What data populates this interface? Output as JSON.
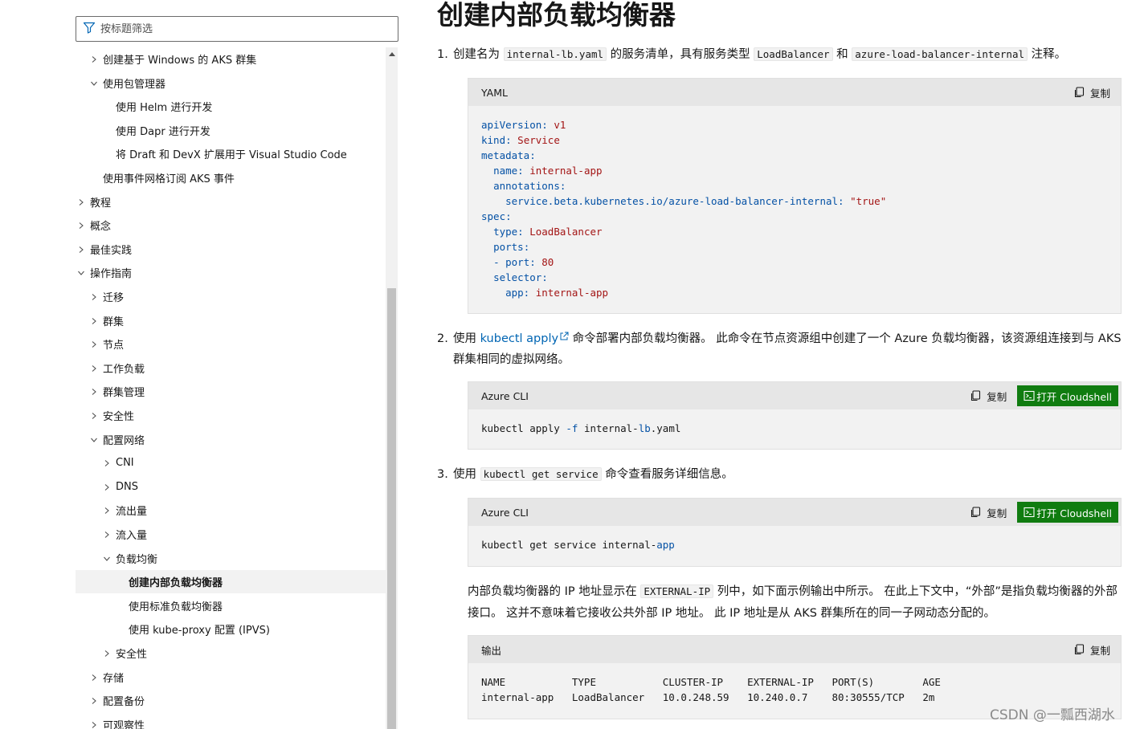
{
  "sidebar": {
    "filter_placeholder": "按标题筛选",
    "items": [
      {
        "label": "创建基于 Windows 的 AKS 群集",
        "level": 1,
        "chevron": "right"
      },
      {
        "label": "使用包管理器",
        "level": 1,
        "chevron": "down"
      },
      {
        "label": "使用 Helm 进行开发",
        "level": 2,
        "chevron": "none"
      },
      {
        "label": "使用 Dapr 进行开发",
        "level": 2,
        "chevron": "none"
      },
      {
        "label": "将 Draft 和 DevX 扩展用于 Visual Studio Code",
        "level": 2,
        "chevron": "none"
      },
      {
        "label": "使用事件网格订阅 AKS 事件",
        "level": 1,
        "chevron": "none"
      },
      {
        "label": "教程",
        "level": 0,
        "chevron": "right"
      },
      {
        "label": "概念",
        "level": 0,
        "chevron": "right"
      },
      {
        "label": "最佳实践",
        "level": 0,
        "chevron": "right"
      },
      {
        "label": "操作指南",
        "level": 0,
        "chevron": "down"
      },
      {
        "label": "迁移",
        "level": 1,
        "chevron": "right"
      },
      {
        "label": "群集",
        "level": 1,
        "chevron": "right"
      },
      {
        "label": "节点",
        "level": 1,
        "chevron": "right"
      },
      {
        "label": "工作负载",
        "level": 1,
        "chevron": "right"
      },
      {
        "label": "群集管理",
        "level": 1,
        "chevron": "right"
      },
      {
        "label": "安全性",
        "level": 1,
        "chevron": "right"
      },
      {
        "label": "配置网络",
        "level": 1,
        "chevron": "down"
      },
      {
        "label": "CNI",
        "level": 2,
        "chevron": "right"
      },
      {
        "label": "DNS",
        "level": 2,
        "chevron": "right"
      },
      {
        "label": "流出量",
        "level": 2,
        "chevron": "right"
      },
      {
        "label": "流入量",
        "level": 2,
        "chevron": "right"
      },
      {
        "label": "负载均衡",
        "level": 2,
        "chevron": "down"
      },
      {
        "label": "创建内部负载均衡器",
        "level": 3,
        "chevron": "none",
        "active": true
      },
      {
        "label": "使用标准负载均衡器",
        "level": 3,
        "chevron": "none"
      },
      {
        "label": "使用 kube-proxy 配置 (IPVS)",
        "level": 3,
        "chevron": "none"
      },
      {
        "label": "安全性",
        "level": 2,
        "chevron": "right"
      },
      {
        "label": "存储",
        "level": 1,
        "chevron": "right"
      },
      {
        "label": "配置备份",
        "level": 1,
        "chevron": "right"
      },
      {
        "label": "可观察性",
        "level": 1,
        "chevron": "right"
      }
    ]
  },
  "main": {
    "title": "创建内部负载均衡器",
    "step1": {
      "num": "1.",
      "t1": "创建名为 ",
      "code1": "internal-lb.yaml",
      "t2": " 的服务清单，具有服务类型 ",
      "code2": "LoadBalancer",
      "t3": " 和 ",
      "code3": "azure-load-balancer-internal",
      "t4": " 注释。"
    },
    "yaml_block": {
      "lang": "YAML",
      "copy_label": "复制",
      "lines": [
        {
          "indent": "",
          "key": "apiVersion:",
          "val": " v1"
        },
        {
          "indent": "",
          "key": "kind:",
          "val": " Service"
        },
        {
          "indent": "",
          "key": "metadata:",
          "val": ""
        },
        {
          "indent": "  ",
          "key": "name:",
          "val": " internal-app"
        },
        {
          "indent": "  ",
          "key": "annotations:",
          "val": ""
        },
        {
          "indent": "    ",
          "key": "service.beta.kubernetes.io/azure-load-balancer-internal:",
          "val": " \"true\""
        },
        {
          "indent": "",
          "key": "spec:",
          "val": ""
        },
        {
          "indent": "  ",
          "key": "type:",
          "val": " LoadBalancer"
        },
        {
          "indent": "  ",
          "key": "ports:",
          "val": ""
        },
        {
          "indent": "  ",
          "key": "- port:",
          "val": " 80"
        },
        {
          "indent": "  ",
          "key": "selector:",
          "val": ""
        },
        {
          "indent": "    ",
          "key": "app:",
          "val": " internal-app"
        }
      ]
    },
    "step2": {
      "num": "2.",
      "t1": "使用 ",
      "link": "kubectl apply",
      "t2": " 命令部署内部负载均衡器。 此命令在节点资源组中创建了一个 Azure 负载均衡器，该资源组连接到与 AKS 群集相同的虚拟网络。"
    },
    "cli_block1": {
      "lang": "Azure CLI",
      "copy_label": "复制",
      "cloudshell_label": "打开 Cloudshell",
      "c1": "kubectl apply ",
      "c2": "-f",
      "c3": " internal-",
      "c4": "lb",
      "c5": ".yaml"
    },
    "step3": {
      "num": "3.",
      "t1": "使用 ",
      "code1": "kubectl get service",
      "t2": " 命令查看服务详细信息。"
    },
    "cli_block2": {
      "lang": "Azure CLI",
      "copy_label": "复制",
      "cloudshell_label": "打开 Cloudshell",
      "c1": "kubectl get service internal-",
      "c2": "app"
    },
    "para": {
      "t1": "内部负载均衡器的 IP 地址显示在 ",
      "code1": "EXTERNAL-IP",
      "t2": " 列中，如下面示例输出中所示。 在此上下文中，“外部”是指负载均衡器的外部接口。 这并不意味着它接收公共外部 IP 地址。 此 IP 地址是从 AKS 群集所在的同一子网动态分配的。"
    },
    "output_block": {
      "lang": "输出",
      "copy_label": "复制",
      "header_line": "NAME           TYPE           CLUSTER-IP    EXTERNAL-IP   PORT(S)        AGE",
      "row_line": "internal-app   LoadBalancer   10.0.248.59   10.240.0.7    80:30555/TCP   2m"
    }
  },
  "watermark": "CSDN @一瓢西湖水",
  "colors": {
    "link": "#0065b3",
    "cloudshell_bg": "#107c10",
    "yaml_key": "#0451a5",
    "yaml_value": "#a31515",
    "code_bg": "#f2f2f2",
    "code_header_bg": "#e6e6e6"
  }
}
